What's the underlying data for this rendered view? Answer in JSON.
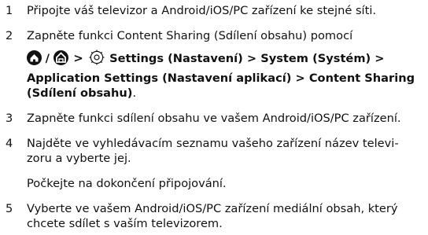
{
  "steps": [
    {
      "num": "1",
      "lines": [
        "Připojte váš televizor a Android/iOS/PC zařízení ke stejné síti."
      ]
    },
    {
      "num": "2",
      "lines": [
        "Zapněte funkci Content Sharing (Sdílení obsahu) pomocí"
      ]
    },
    {
      "num": "3",
      "lines": [
        "Zapněte funkci sdílení obsahu ve vašem Android/iOS/PC zařízení."
      ]
    },
    {
      "num": "4",
      "lines": [
        "Najděte ve vyhledávacím seznamu vašeho zařízení název televi-",
        "zoru a vyberte jej."
      ]
    },
    {
      "num": "5",
      "lines": [
        "Vyberte ve vašem Android/iOS/PC zařízení mediální obsah, který",
        "chcete sdílet s vaším televizorem."
      ]
    }
  ],
  "menu_path": {
    "slash": "/",
    "gt": ">",
    "settings": "Settings (Nastavení)",
    "sep1": " > ",
    "system": "System (Systém)",
    "sep2": " >",
    "app_settings": "Application Settings (Nastavení aplikací)",
    "sep3": " > ",
    "content_sharing": "Content Sharing",
    "sdileni": "(Sdílení obsahu)",
    "period": "."
  },
  "step4_note": "Počkejte na dokončení připojování.",
  "icons": [
    "home-icon",
    "home-icon",
    "gear-icon"
  ]
}
